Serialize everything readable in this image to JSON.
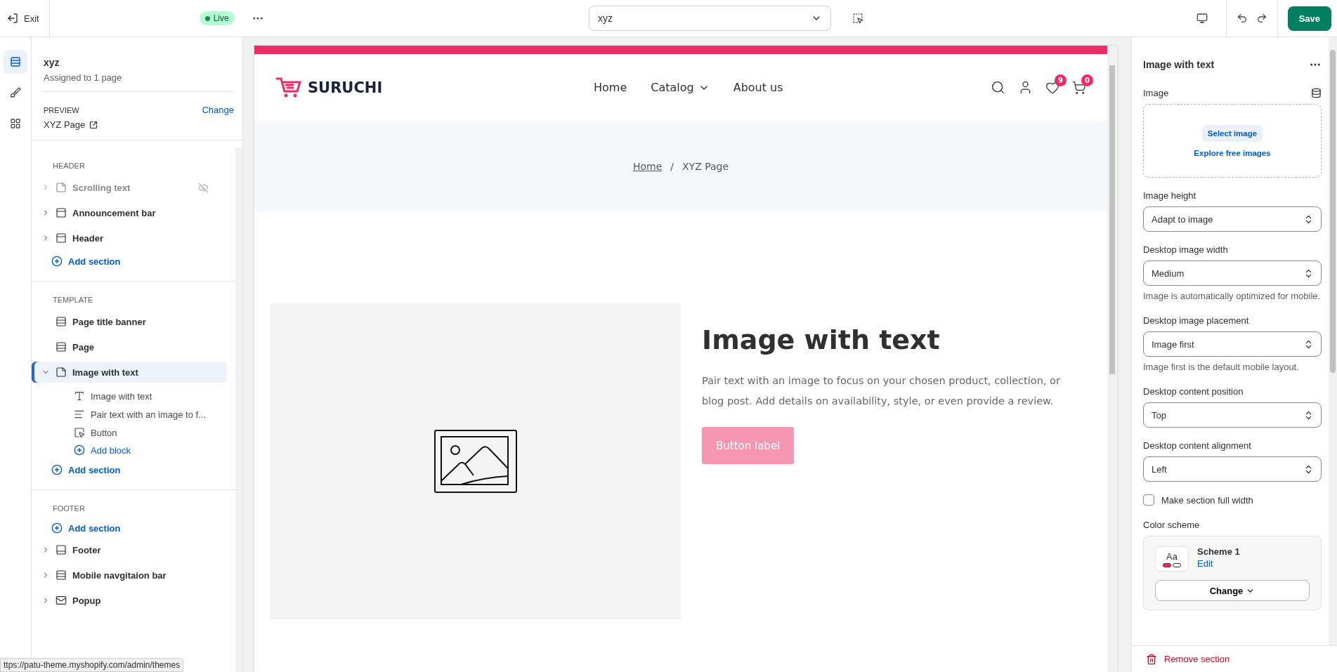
{
  "topbar": {
    "exit": "Exit",
    "status": {
      "label": "Live",
      "live": true
    },
    "page_select": "xyz",
    "save": "Save"
  },
  "rail": [
    {
      "kind": "sections",
      "selected": true
    },
    {
      "kind": "theme",
      "selected": false
    },
    {
      "kind": "apps",
      "selected": false
    }
  ],
  "template": {
    "name": "xyz",
    "assigned": "Assigned to 1 page",
    "preview_label": "PREVIEW",
    "preview_action": "Change",
    "preview_page": "XYZ Page"
  },
  "groups": [
    {
      "title": "HEADER",
      "add_label": "Add section",
      "sections": [
        {
          "label": "Scrolling text",
          "kind": "text",
          "hidden": true,
          "expanded": false,
          "selected": false
        },
        {
          "label": "Announcement bar",
          "kind": "header",
          "hidden": false,
          "expanded": false,
          "selected": false
        },
        {
          "label": "Header",
          "kind": "header",
          "hidden": false,
          "expanded": false,
          "selected": false
        }
      ]
    },
    {
      "title": "TEMPLATE",
      "add_label": "Add section",
      "sections": [
        {
          "label": "Page title banner",
          "kind": "banner",
          "selected": false
        },
        {
          "label": "Page",
          "kind": "banner",
          "selected": false
        },
        {
          "label": "Image with text",
          "kind": "text",
          "hidden": false,
          "expanded": true,
          "selected": true,
          "add_block": "Add block",
          "children": [
            {
              "label": "Image with text",
              "kind": "heading"
            },
            {
              "label": "Pair text with an image to f...",
              "kind": "paragraph"
            },
            {
              "label": "Button",
              "kind": "button"
            }
          ]
        }
      ]
    },
    {
      "title": "FOOTER",
      "add_label": "Add section",
      "add_first": true,
      "sections": [
        {
          "label": "Footer",
          "kind": "footer",
          "hidden": false,
          "expanded": false,
          "selected": false
        },
        {
          "label": "Mobile navgitaion bar",
          "kind": "banner",
          "hidden": false,
          "expanded": false,
          "selected": false
        },
        {
          "label": "Popup",
          "kind": "popup",
          "hidden": false,
          "expanded": false,
          "selected": false
        }
      ]
    }
  ],
  "status_url": "ttps://patu-theme.myshopify.com/admin/themes",
  "preview": {
    "brand": "SURUCHI",
    "nav": [
      {
        "label": "Home",
        "dropdown": false
      },
      {
        "label": "Catalog",
        "dropdown": true
      },
      {
        "label": "About us",
        "dropdown": false
      }
    ],
    "wishlist_count": "9",
    "cart_count": "0",
    "breadcrumb": {
      "link": "Home",
      "separator": "/",
      "current": "XYZ Page"
    },
    "heading": "Image with text",
    "text": "Pair text with an image to focus on your chosen product, collection, or blog post. Add details on availability, style, or even provide a review.",
    "button": "Button label"
  },
  "settings": {
    "title": "Image with text",
    "fields": [
      {
        "kind": "image",
        "label": "Image",
        "action": "Select image",
        "link": "Explore free images"
      },
      {
        "kind": "select",
        "label": "Image height",
        "value": "Adapt to image"
      },
      {
        "kind": "select",
        "label": "Desktop image width",
        "value": "Medium",
        "help": "Image is automatically optimized for mobile."
      },
      {
        "kind": "select",
        "label": "Desktop image placement",
        "value": "Image first",
        "help": "Image first is the default mobile layout."
      },
      {
        "kind": "select",
        "label": "Desktop content position",
        "value": "Top"
      },
      {
        "kind": "select",
        "label": "Desktop content alignment",
        "value": "Left"
      },
      {
        "kind": "checkbox",
        "label": "Make section full width",
        "checked": false
      },
      {
        "kind": "scheme",
        "label": "Color scheme",
        "sample": "Aa",
        "name": "Scheme 1",
        "edit": "Edit",
        "change": "Change"
      }
    ],
    "remove": "Remove section"
  }
}
